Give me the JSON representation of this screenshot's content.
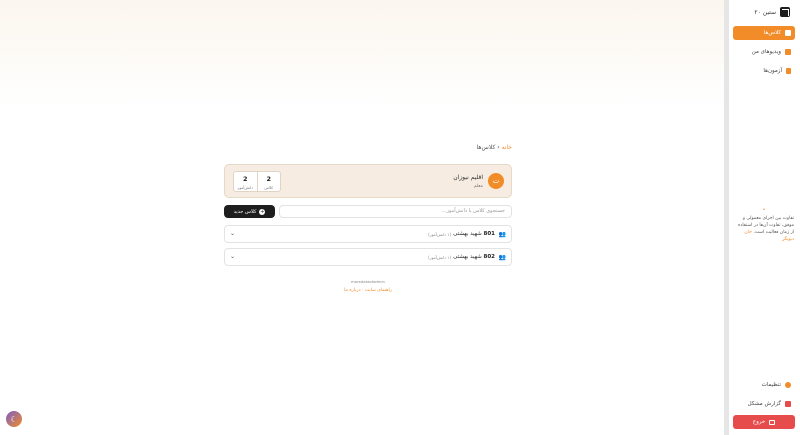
{
  "sidebar": {
    "brand": "ستین ۲۰",
    "items": [
      {
        "label": "کلاس‌ها",
        "icon": "users-icon",
        "active": true
      },
      {
        "label": "ویدیوهای من",
        "icon": "video-icon",
        "active": false
      },
      {
        "label": "آزمون‌ها",
        "icon": "document-icon",
        "active": false
      }
    ],
    "tip": {
      "quote": "“",
      "text": "تفاوت بین اجرای معمولی و موفق، تفاوت آن‌ها در استفاده از زمان فعالیت است.",
      "link": "جان دیویگز"
    },
    "settings_label": "تنظیمات",
    "report_label": "گزارش مشکل",
    "logout_label": "خروج"
  },
  "breadcrumb": {
    "home": "خانه",
    "separator": "‹",
    "current": "کلاس‌ها"
  },
  "profile": {
    "avatar_letter": "ت",
    "name": "اقلیم نیوزان",
    "role": "معلم",
    "stats": [
      {
        "value": "2",
        "label": "کلاس"
      },
      {
        "value": "2",
        "label": "دانش‌آموز"
      }
    ]
  },
  "search": {
    "placeholder": "جستجوی کلاس یا دانش‌آموز..."
  },
  "new_class_button": {
    "label": "کلاس جدید",
    "icon": "+"
  },
  "classes": [
    {
      "code": "801",
      "name": "شهید بهشتی",
      "count": "(۱ دانش‌آموز)"
    },
    {
      "code": "802",
      "name": "شهید بهشتی",
      "count": "(۱ دانش‌آموز)"
    }
  ],
  "footer": {
    "small": "moredataofadmin",
    "link1": "راهنمای سایت",
    "link2": "درباره ما"
  },
  "colors": {
    "accent": "#f28c28",
    "danger": "#e74c4c",
    "dark": "#1e1e1e"
  }
}
